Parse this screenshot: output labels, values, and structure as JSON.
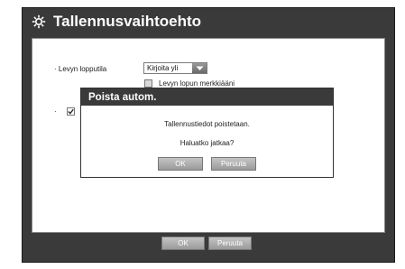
{
  "window": {
    "title": "Tallennusvaihtoehto",
    "icon": "gear-icon"
  },
  "settings": {
    "disk_end_label": "· Levyn lopputila",
    "disk_end_value": "Kirjoita yli",
    "disk_end_beep_label": "Levyn lopun merkkiääni",
    "auto_delete_prefix": "·"
  },
  "footer": {
    "ok_label": "OK",
    "cancel_label": "Peruuta"
  },
  "dialog": {
    "title": "Poista autom.",
    "message_line1": "Tallennustiedot poistetaan.",
    "message_line2": "Haluatko jatkaa?",
    "ok_label": "OK",
    "cancel_label": "Peruuta"
  },
  "colors": {
    "frame": "#3a3a3a",
    "button": "#b0b0b0"
  }
}
